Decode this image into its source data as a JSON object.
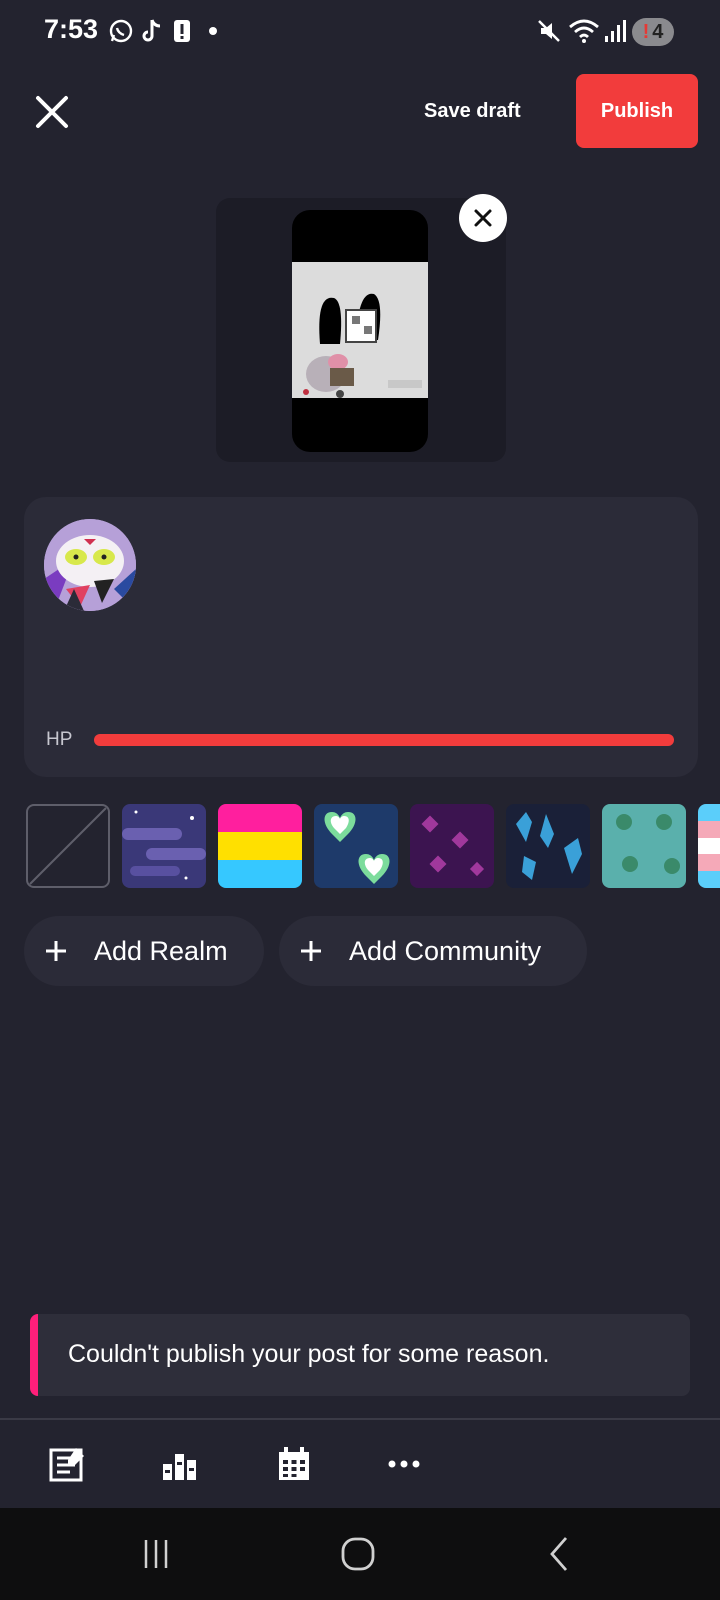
{
  "status_bar": {
    "time": "7:53",
    "notification_count": "4",
    "alert_mark": "!"
  },
  "top_bar": {
    "save_draft_label": "Save draft",
    "publish_label": "Publish"
  },
  "post": {
    "hp_label": "HP",
    "hp_fraction": 1.0
  },
  "chips": {
    "add_realm_label": "Add Realm",
    "add_community_label": "Add Community"
  },
  "toast": {
    "message": "Couldn't publish your post for some reason."
  },
  "colors": {
    "accent": "#f23c3c",
    "toast_accent": "#ff1f7a",
    "background": "#23232f"
  },
  "icons": {
    "close": "close-icon",
    "remove_media": "close-icon",
    "toolbar": [
      "editor-icon",
      "stats-icon",
      "calendar-icon",
      "more-icon"
    ],
    "nav": [
      "recents-icon",
      "home-icon",
      "back-icon"
    ]
  }
}
